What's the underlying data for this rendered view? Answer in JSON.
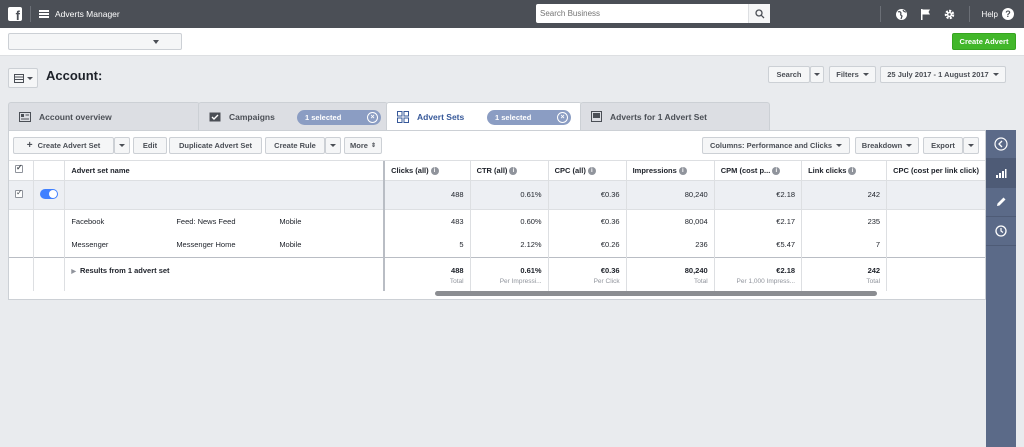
{
  "topbar": {
    "app_title": "Adverts Manager",
    "search_placeholder": "Search Business",
    "help_label": "Help"
  },
  "subbar": {
    "account_select_value": "",
    "create_advert_label": "Create Advert"
  },
  "account": {
    "title": "Account:",
    "search_label": "Search",
    "filters_label": "Filters",
    "date_range": "25 July 2017 - 1 August 2017"
  },
  "tabs": [
    {
      "label": "Account overview"
    },
    {
      "label": "Campaigns",
      "pill": "1 selected"
    },
    {
      "label": "Advert Sets",
      "pill": "1 selected"
    },
    {
      "label": "Adverts for 1 Advert Set"
    }
  ],
  "toolbar": {
    "create_label": "Create Advert Set",
    "edit_label": "Edit",
    "duplicate_label": "Duplicate Advert Set",
    "create_rule_label": "Create Rule",
    "more_label": "More",
    "columns_label": "Columns: Performance and Clicks",
    "breakdown_label": "Breakdown",
    "export_label": "Export"
  },
  "table": {
    "headers": [
      "Advert set name",
      "Clicks (all)",
      "CTR (all)",
      "CPC (all)",
      "Impressions",
      "CPM (cost p...",
      "Link clicks",
      "CPC (cost per link click)"
    ],
    "selected_row": {
      "clicks": "488",
      "ctr": "0.61%",
      "cpc": "€0.36",
      "impressions": "80,240",
      "cpm": "€2.18",
      "link_clicks": "242"
    },
    "rows": [
      {
        "name": "Facebook",
        "placement": "Feed: News Feed",
        "device": "Mobile",
        "clicks": "483",
        "ctr": "0.60%",
        "cpc": "€0.36",
        "impressions": "80,004",
        "cpm": "€2.17",
        "link_clicks": "235"
      },
      {
        "name": "Messenger",
        "placement": "Messenger Home",
        "device": "Mobile",
        "clicks": "5",
        "ctr": "2.12%",
        "cpc": "€0.26",
        "impressions": "236",
        "cpm": "€5.47",
        "link_clicks": "7"
      }
    ],
    "totals": {
      "label": "Results from 1 advert set",
      "clicks": "488",
      "clicks_sub": "Total",
      "ctr": "0.61%",
      "ctr_sub": "Per Impressi...",
      "cpc": "€0.36",
      "cpc_sub": "Per Click",
      "impressions": "80,240",
      "impressions_sub": "Total",
      "cpm": "€2.18",
      "cpm_sub": "Per 1,000 Impress...",
      "link_clicks": "242",
      "link_clicks_sub": "Total"
    }
  }
}
